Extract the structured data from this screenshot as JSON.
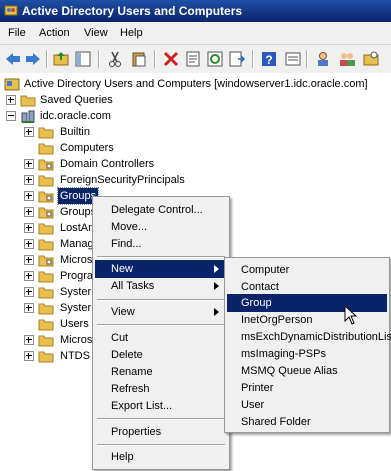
{
  "window": {
    "title": "Active Directory Users and Computers"
  },
  "menubar": [
    {
      "label": "File"
    },
    {
      "label": "Action"
    },
    {
      "label": "View"
    },
    {
      "label": "Help"
    }
  ],
  "tree": {
    "root": "Active Directory Users and Computers [windowserver1.idc.oracle.com]",
    "saved_queries": "Saved Queries",
    "domain": "idc.oracle.com",
    "containers": [
      "Builtin",
      "Computers",
      "Domain Controllers",
      "ForeignSecurityPrincipals",
      "Groups",
      "Groups",
      "LostAn",
      "Manag",
      "Micros",
      "Progra",
      "Syster",
      "Syster",
      "Users",
      "Micros",
      "NTDS Q"
    ]
  },
  "context_menu": {
    "items": [
      "Delegate Control...",
      "Move...",
      "Find...",
      "New",
      "All Tasks",
      "View",
      "Cut",
      "Delete",
      "Rename",
      "Refresh",
      "Export List...",
      "Properties",
      "Help"
    ]
  },
  "submenu": {
    "items": [
      "Computer",
      "Contact",
      "Group",
      "InetOrgPerson",
      "msExchDynamicDistributionList",
      "msImaging-PSPs",
      "MSMQ Queue Alias",
      "Printer",
      "User",
      "Shared Folder"
    ]
  },
  "colors": {
    "highlight": "#0a246a",
    "folder": "#e8c050",
    "menu_bg": "#f0f0f0"
  }
}
